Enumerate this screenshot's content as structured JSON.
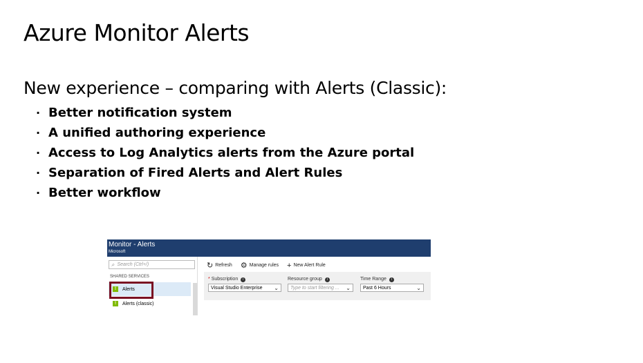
{
  "slide": {
    "title": "Azure Monitor Alerts",
    "subtitle": "New experience – comparing with Alerts (Classic):",
    "bullets": [
      "Better notification system",
      "A unified authoring experience",
      "Access to Log Analytics alerts from the Azure portal",
      "Separation of Fired Alerts and Alert Rules",
      "Better workflow"
    ]
  },
  "portal": {
    "header": {
      "title": "Monitor - Alerts",
      "subtitle": "Microsoft",
      "color": "#1f3e6e"
    },
    "search": {
      "placeholder": "Search (Ctrl+/)",
      "icon": "search-icon"
    },
    "sidebar": {
      "section": "SHARED SERVICES",
      "items": [
        {
          "label": "Alerts",
          "active": true,
          "icon": "alert-icon"
        },
        {
          "label": "Alerts (classic)",
          "active": false,
          "icon": "alert-icon"
        }
      ]
    },
    "toolbar": {
      "refresh": "Refresh",
      "manage_rules": "Manage rules",
      "new_alert_rule": "New Alert Rule"
    },
    "filters": {
      "subscription_label": "Subscription",
      "subscription_value": "Visual Studio Enterprise",
      "resource_group_label": "Resource group",
      "resource_group_placeholder": "Type to start filtering ...",
      "time_range_label": "Time Range",
      "time_range_value": "Past 6 Hours"
    },
    "highlight_color": "#7a1022"
  }
}
